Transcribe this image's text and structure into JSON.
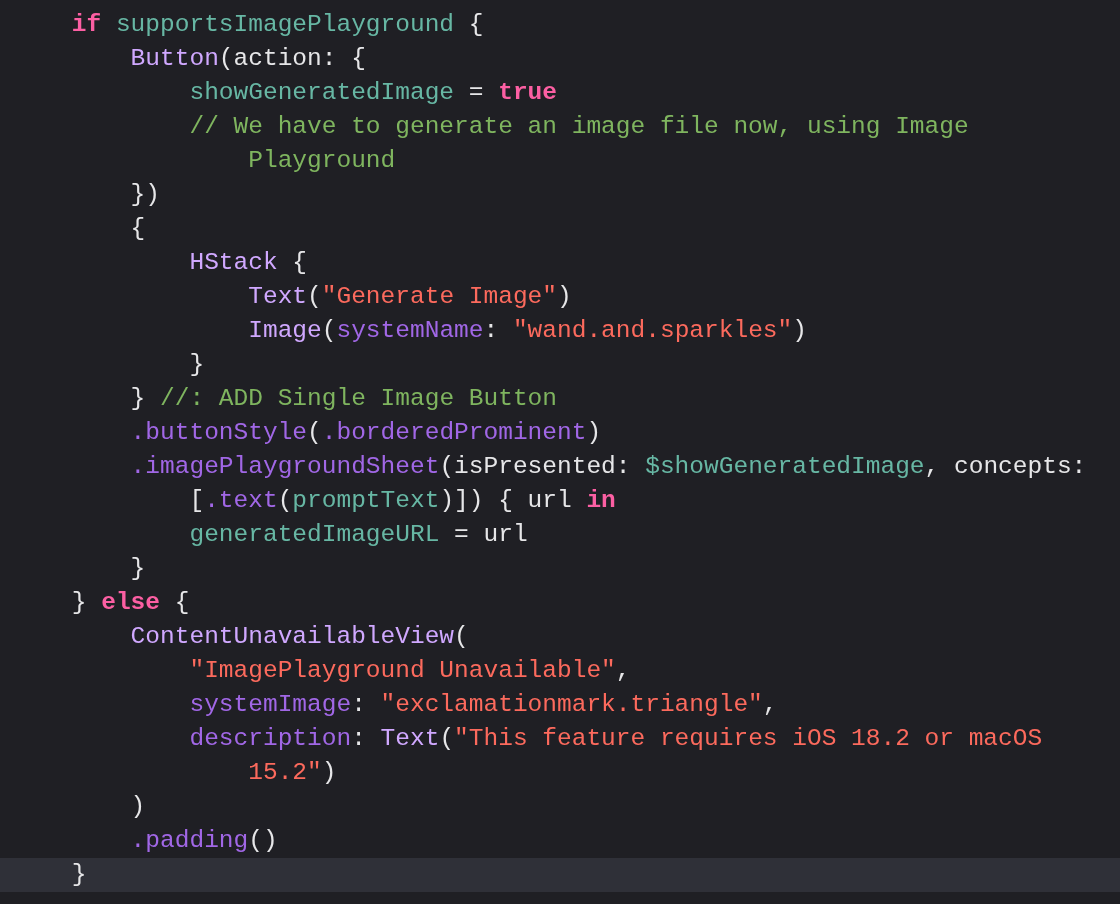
{
  "editor": {
    "lines": [
      {
        "current": false,
        "tokens": [
          {
            "text": "    if",
            "kind": "keyword"
          },
          {
            "text": " supportsImagePlayground",
            "kind": "variable"
          },
          {
            "text": " {",
            "kind": "plain"
          }
        ]
      },
      {
        "current": false,
        "tokens": [
          {
            "text": "        Button",
            "kind": "type"
          },
          {
            "text": "(action: {",
            "kind": "plain"
          }
        ]
      },
      {
        "current": false,
        "tokens": [
          {
            "text": "            showGeneratedImage",
            "kind": "variable"
          },
          {
            "text": " = ",
            "kind": "plain"
          },
          {
            "text": "true",
            "kind": "keyword"
          }
        ]
      },
      {
        "current": false,
        "tokens": [
          {
            "text": "            // We have to generate an image file now, using Image",
            "kind": "comment"
          }
        ]
      },
      {
        "current": false,
        "tokens": [
          {
            "text": "                Playground",
            "kind": "comment"
          }
        ]
      },
      {
        "current": false,
        "tokens": [
          {
            "text": "        })",
            "kind": "plain"
          }
        ]
      },
      {
        "current": false,
        "tokens": [
          {
            "text": "        {",
            "kind": "plain"
          }
        ]
      },
      {
        "current": false,
        "tokens": [
          {
            "text": "            HStack",
            "kind": "type"
          },
          {
            "text": " {",
            "kind": "plain"
          }
        ]
      },
      {
        "current": false,
        "tokens": [
          {
            "text": "                Text",
            "kind": "type"
          },
          {
            "text": "(",
            "kind": "plain"
          },
          {
            "text": "\"Generate Image\"",
            "kind": "string"
          },
          {
            "text": ")",
            "kind": "plain"
          }
        ]
      },
      {
        "current": false,
        "tokens": [
          {
            "text": "                Image",
            "kind": "type"
          },
          {
            "text": "(",
            "kind": "plain"
          },
          {
            "text": "systemName",
            "kind": "member"
          },
          {
            "text": ": ",
            "kind": "plain"
          },
          {
            "text": "\"wand.and.sparkles\"",
            "kind": "string"
          },
          {
            "text": ")",
            "kind": "plain"
          }
        ]
      },
      {
        "current": false,
        "tokens": [
          {
            "text": "            }",
            "kind": "plain"
          }
        ]
      },
      {
        "current": false,
        "tokens": [
          {
            "text": "        } ",
            "kind": "plain"
          },
          {
            "text": "//: ADD Single Image Button",
            "kind": "comment"
          }
        ]
      },
      {
        "current": false,
        "tokens": [
          {
            "text": "        .buttonStyle",
            "kind": "member"
          },
          {
            "text": "(",
            "kind": "plain"
          },
          {
            "text": ".borderedProminent",
            "kind": "member"
          },
          {
            "text": ")",
            "kind": "plain"
          }
        ]
      },
      {
        "current": false,
        "tokens": [
          {
            "text": "        .imagePlaygroundSheet",
            "kind": "member"
          },
          {
            "text": "(isPresented: ",
            "kind": "plain"
          },
          {
            "text": "$showGeneratedImage",
            "kind": "variable"
          },
          {
            "text": ", concepts:",
            "kind": "plain"
          }
        ]
      },
      {
        "current": false,
        "tokens": [
          {
            "text": "            [",
            "kind": "plain"
          },
          {
            "text": ".text",
            "kind": "member"
          },
          {
            "text": "(",
            "kind": "plain"
          },
          {
            "text": "promptText",
            "kind": "variable"
          },
          {
            "text": ")]) { url ",
            "kind": "plain"
          },
          {
            "text": "in",
            "kind": "keyword"
          }
        ]
      },
      {
        "current": false,
        "tokens": [
          {
            "text": "            generatedImageURL",
            "kind": "variable"
          },
          {
            "text": " = url",
            "kind": "plain"
          }
        ]
      },
      {
        "current": false,
        "tokens": [
          {
            "text": "        }",
            "kind": "plain"
          }
        ]
      },
      {
        "current": false,
        "tokens": [
          {
            "text": "    } ",
            "kind": "plain"
          },
          {
            "text": "else",
            "kind": "keyword"
          },
          {
            "text": " {",
            "kind": "plain"
          }
        ]
      },
      {
        "current": false,
        "tokens": [
          {
            "text": "        ContentUnavailableView",
            "kind": "type"
          },
          {
            "text": "(",
            "kind": "plain"
          }
        ]
      },
      {
        "current": false,
        "tokens": [
          {
            "text": "            \"ImagePlayground Unavailable\"",
            "kind": "string"
          },
          {
            "text": ",",
            "kind": "plain"
          }
        ]
      },
      {
        "current": false,
        "tokens": [
          {
            "text": "            systemImage",
            "kind": "member"
          },
          {
            "text": ": ",
            "kind": "plain"
          },
          {
            "text": "\"exclamationmark.triangle\"",
            "kind": "string"
          },
          {
            "text": ",",
            "kind": "plain"
          }
        ]
      },
      {
        "current": false,
        "tokens": [
          {
            "text": "            description",
            "kind": "member"
          },
          {
            "text": ": ",
            "kind": "plain"
          },
          {
            "text": "Text",
            "kind": "type"
          },
          {
            "text": "(",
            "kind": "plain"
          },
          {
            "text": "\"This feature requires iOS 18.2 or macOS",
            "kind": "string"
          }
        ]
      },
      {
        "current": false,
        "tokens": [
          {
            "text": "                15.2\"",
            "kind": "string"
          },
          {
            "text": ")",
            "kind": "plain"
          }
        ]
      },
      {
        "current": false,
        "tokens": [
          {
            "text": "        )",
            "kind": "plain"
          }
        ]
      },
      {
        "current": false,
        "tokens": [
          {
            "text": "        .padding",
            "kind": "member"
          },
          {
            "text": "()",
            "kind": "plain"
          }
        ]
      },
      {
        "current": true,
        "tokens": [
          {
            "text": "    }",
            "kind": "plain"
          }
        ]
      }
    ]
  }
}
